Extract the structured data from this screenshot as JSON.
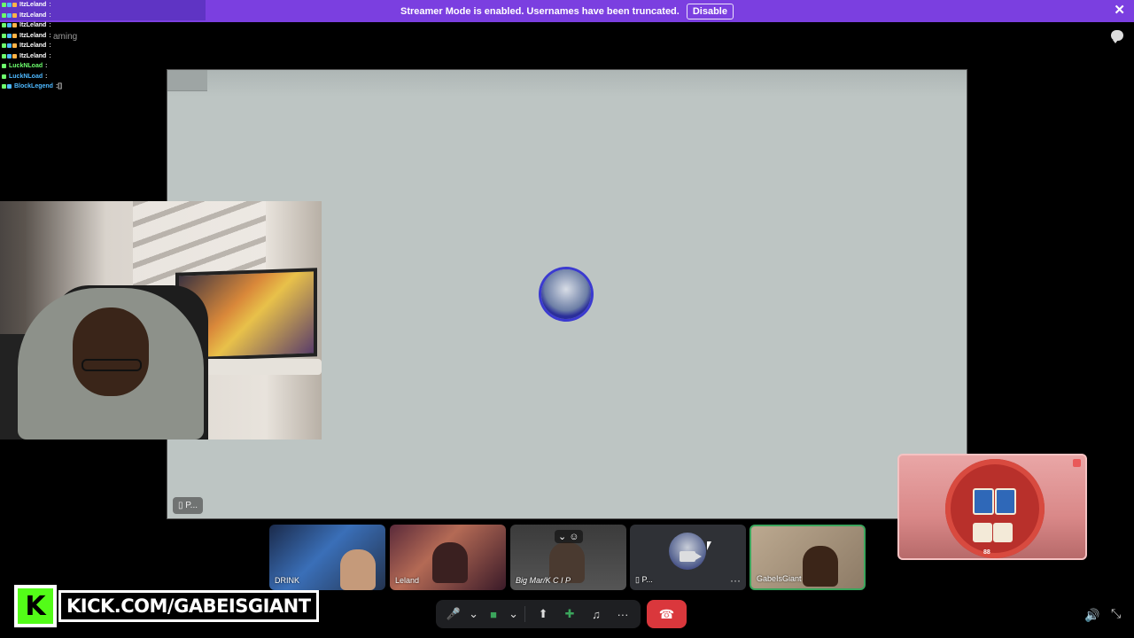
{
  "banner": {
    "message": "Streamer Mode is enabled. Usernames have been truncated.",
    "disable_label": "Disable",
    "close_glyph": "✕",
    "color": "#7b3fe0"
  },
  "chat": {
    "lines": [
      {
        "user": "ItzLeland",
        "msg": ":"
      },
      {
        "user": "ItzLeland",
        "msg": ":"
      },
      {
        "user": "ItzLeland",
        "msg": ":"
      },
      {
        "user": "ItzLeland",
        "msg": ":"
      },
      {
        "user": "ItzLeland",
        "msg": ":"
      },
      {
        "user": "ItzLeland",
        "msg": ":"
      },
      {
        "user": "LuckNLoad",
        "msg": ":"
      },
      {
        "user": "LuckNLoad",
        "msg": ":"
      },
      {
        "user": "BlockLegend",
        "msg": ":[]"
      }
    ],
    "ghost_label": "aming"
  },
  "stage": {
    "tag_label": "P..."
  },
  "participants": [
    {
      "label": "DRINK"
    },
    {
      "label": "Leland"
    },
    {
      "label": "Big Mar/K C I P"
    },
    {
      "label": "P..."
    },
    {
      "label": "GabeIsGiant"
    }
  ],
  "kick": {
    "logo_letter": "K",
    "url": "KICK.COM/GABEISGIANT",
    "brand_color": "#53fc18"
  },
  "controls": {
    "mic": "🎤",
    "mic_caret": "⌄",
    "camera": "■",
    "camera_caret": "⌄",
    "screenshare": "⬆",
    "activities": "✚",
    "soundboard": "♫",
    "more": "···",
    "leave": "☎",
    "leave_color": "#da373c"
  },
  "corner": {
    "volume": "🔊",
    "fullscreen": "⤡"
  },
  "game": {
    "counter": "88"
  }
}
